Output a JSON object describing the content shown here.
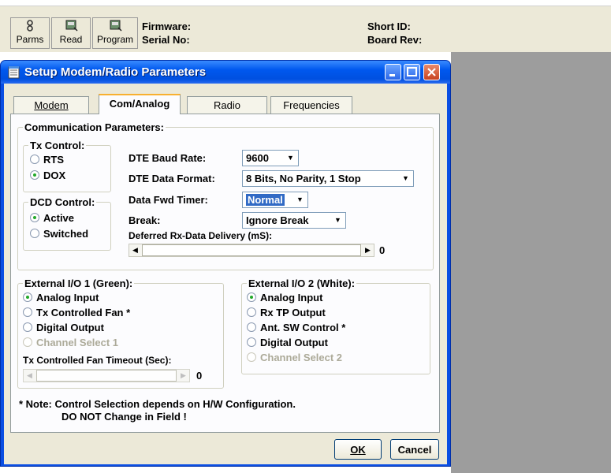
{
  "toolbar": {
    "buttons": [
      {
        "label": "Parms",
        "icon": "parameters-icon"
      },
      {
        "label": "Read",
        "icon": "read-icon"
      },
      {
        "label": "Program",
        "icon": "program-icon"
      }
    ],
    "firmware_label": "Firmware:",
    "serial_label": "Serial No:",
    "short_id_label": "Short ID:",
    "board_rev_label": "Board Rev:"
  },
  "dialog": {
    "title": "Setup Modem/Radio Parameters",
    "tabs": [
      {
        "label": "Modem",
        "active": false
      },
      {
        "label": "Com/Analog",
        "active": true
      },
      {
        "label": "Radio",
        "active": false
      },
      {
        "label": "Frequencies",
        "active": false
      }
    ],
    "comm_group": {
      "title": "Communication Parameters:",
      "tx_control": {
        "title": "Tx Control:",
        "options": [
          {
            "label": "RTS",
            "selected": false
          },
          {
            "label": "DOX",
            "selected": true
          }
        ]
      },
      "dcd_control": {
        "title": "DCD Control:",
        "options": [
          {
            "label": "Active",
            "selected": true
          },
          {
            "label": "Switched",
            "selected": false
          }
        ]
      },
      "baud_rate": {
        "label": "DTE Baud Rate:",
        "value": "9600"
      },
      "data_format": {
        "label": "DTE Data Format:",
        "value": "8 Bits, No Parity, 1 Stop"
      },
      "fwd_timer": {
        "label": "Data Fwd Timer:",
        "value": "Normal"
      },
      "break": {
        "label": "Break:",
        "value": "Ignore Break"
      },
      "deferred": {
        "label": "Deferred Rx-Data Delivery (mS):",
        "value": "0"
      }
    },
    "ext_io_1": {
      "title": "External I/O 1 (Green):",
      "options": [
        {
          "label": "Analog Input",
          "selected": true,
          "disabled": false
        },
        {
          "label": "Tx Controlled Fan *",
          "selected": false,
          "disabled": false
        },
        {
          "label": "Digital Output",
          "selected": false,
          "disabled": false
        },
        {
          "label": "Channel Select 1",
          "selected": false,
          "disabled": true
        }
      ],
      "fan_timeout_label": "Tx Controlled Fan Timeout (Sec):",
      "fan_timeout_value": "0"
    },
    "ext_io_2": {
      "title": "External I/O 2 (White):",
      "options": [
        {
          "label": "Analog Input",
          "selected": true,
          "disabled": false
        },
        {
          "label": "Rx TP Output",
          "selected": false,
          "disabled": false
        },
        {
          "label": "Ant. SW Control *",
          "selected": false,
          "disabled": false
        },
        {
          "label": "Digital Output",
          "selected": false,
          "disabled": false
        },
        {
          "label": "Channel Select 2",
          "selected": false,
          "disabled": true
        }
      ]
    },
    "note_line1": "* Note:  Control Selection depends on H/W Configuration.",
    "note_line2": "DO NOT Change in Field !",
    "ok_label": "OK",
    "cancel_label": "Cancel"
  }
}
